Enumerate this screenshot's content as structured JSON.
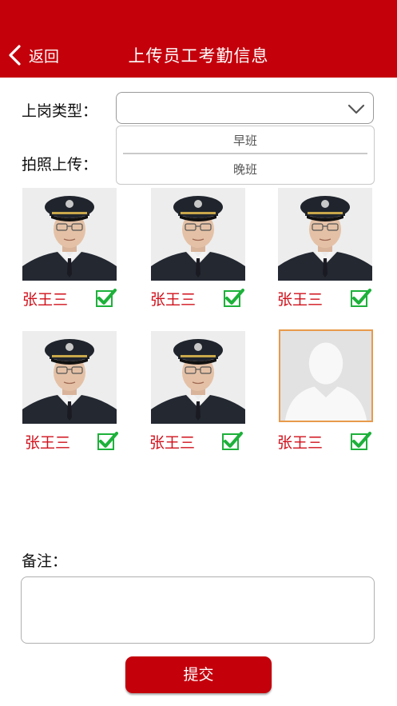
{
  "header": {
    "back_label": "返回",
    "title": "上传员工考勤信息",
    "bg_color": "#c4000b"
  },
  "form": {
    "shift_label": "上岗类型：",
    "shift_value": "",
    "shift_options": [
      "早班",
      "晚班"
    ],
    "photo_label": "拍照上传：",
    "notes_label": "备注：",
    "notes_value": ""
  },
  "photos": [
    {
      "name": "张王三",
      "checked": true,
      "type": "photo"
    },
    {
      "name": "张王三",
      "checked": true,
      "type": "photo"
    },
    {
      "name": "张王三",
      "checked": true,
      "type": "photo"
    },
    {
      "name": "张王三",
      "checked": true,
      "type": "photo"
    },
    {
      "name": "张王三",
      "checked": true,
      "type": "photo"
    },
    {
      "name": "张王三",
      "checked": true,
      "type": "placeholder",
      "selected": true
    }
  ],
  "submit_label": "提交",
  "colors": {
    "accent": "#c4000b",
    "name_text": "#d0101b",
    "check_green": "#1db13a",
    "selected_border": "#e89a4b"
  }
}
